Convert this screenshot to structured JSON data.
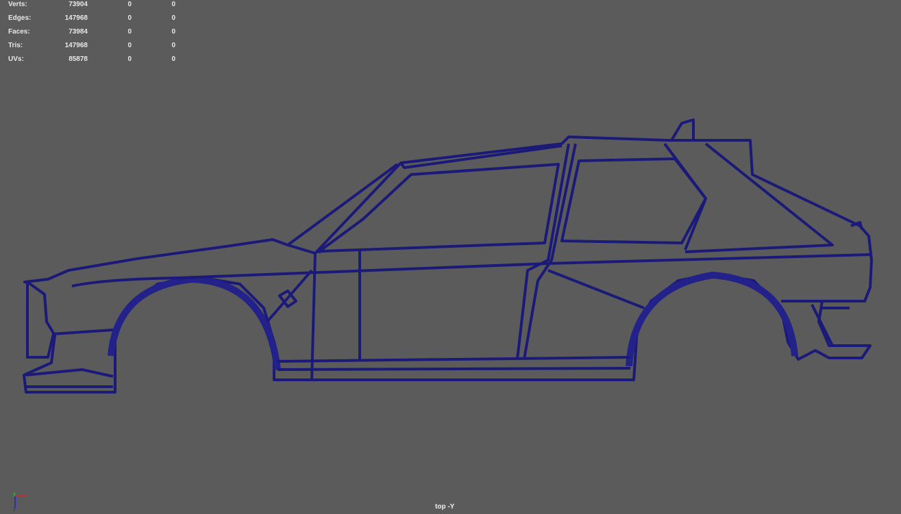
{
  "stats": [
    {
      "label": "Verts:",
      "total": "73904",
      "selected": "0",
      "highlighted": "0"
    },
    {
      "label": "Edges:",
      "total": "147968",
      "selected": "0",
      "highlighted": "0"
    },
    {
      "label": "Faces:",
      "total": "73984",
      "selected": "0",
      "highlighted": "0"
    },
    {
      "label": "Tris:",
      "total": "147968",
      "selected": "0",
      "highlighted": "0"
    },
    {
      "label": "UVs:",
      "total": "85878",
      "selected": "0",
      "highlighted": "0"
    }
  ],
  "camera_label": "top -Y",
  "axis": {
    "x": "x",
    "y": "y",
    "z": "z"
  },
  "colors": {
    "background": "#5b5b5b",
    "wireframe": "#1c1a78",
    "axis_x": "#e02020",
    "axis_y": "#20e020",
    "axis_z": "#2020e0"
  }
}
